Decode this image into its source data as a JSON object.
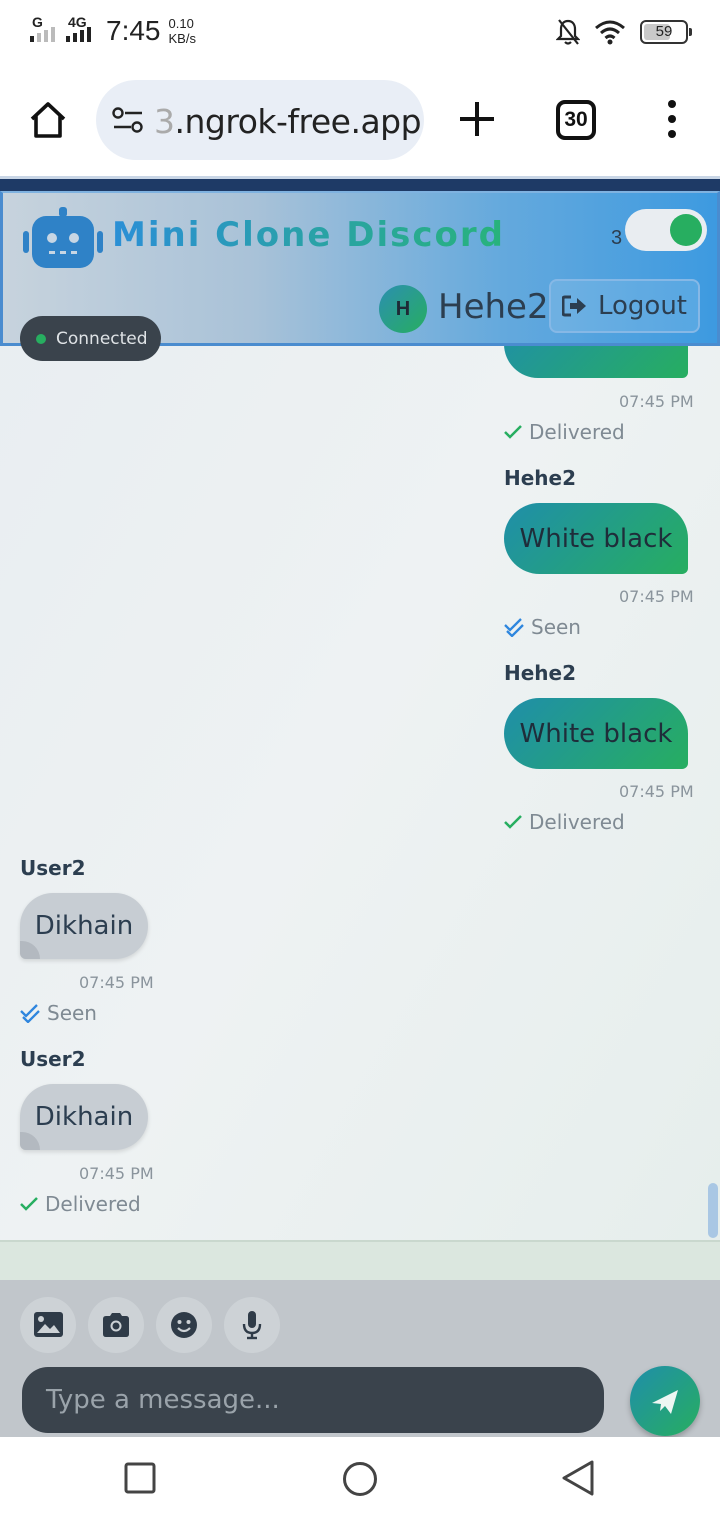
{
  "status_bar": {
    "network1": "G",
    "network2": "4G",
    "time": "7:45",
    "speed_value": "0.10",
    "speed_unit": "KB/s",
    "battery": "59"
  },
  "browser": {
    "url_faded": "3",
    "url": ".ngrok-free.app",
    "tab_count": "30"
  },
  "app": {
    "title": "Mini Clone Discord",
    "toggle_count": "3",
    "user_initial": "H",
    "user_name": "Hehe2",
    "logout_label": "Logout",
    "connection_status": "Connected"
  },
  "messages": [
    {
      "time": "07:45 PM",
      "status": "Delivered"
    },
    {
      "sender": "Hehe2",
      "text": "White black",
      "time": "07:45 PM",
      "status": "Seen"
    },
    {
      "sender": "Hehe2",
      "text": "White black",
      "time": "07:45 PM",
      "status": "Delivered"
    },
    {
      "sender": "User2",
      "text": "Dikhain",
      "time": "07:45 PM",
      "status": "Seen"
    },
    {
      "sender": "User2",
      "text": "Dikhain",
      "time": "07:45 PM",
      "status": "Delivered"
    }
  ],
  "composer": {
    "placeholder": "Type a message..."
  },
  "colors": {
    "accent_teal": "#1f8eaa",
    "accent_green": "#27ae60",
    "delivered_check": "#27ae60",
    "seen_check": "#2e86de"
  }
}
